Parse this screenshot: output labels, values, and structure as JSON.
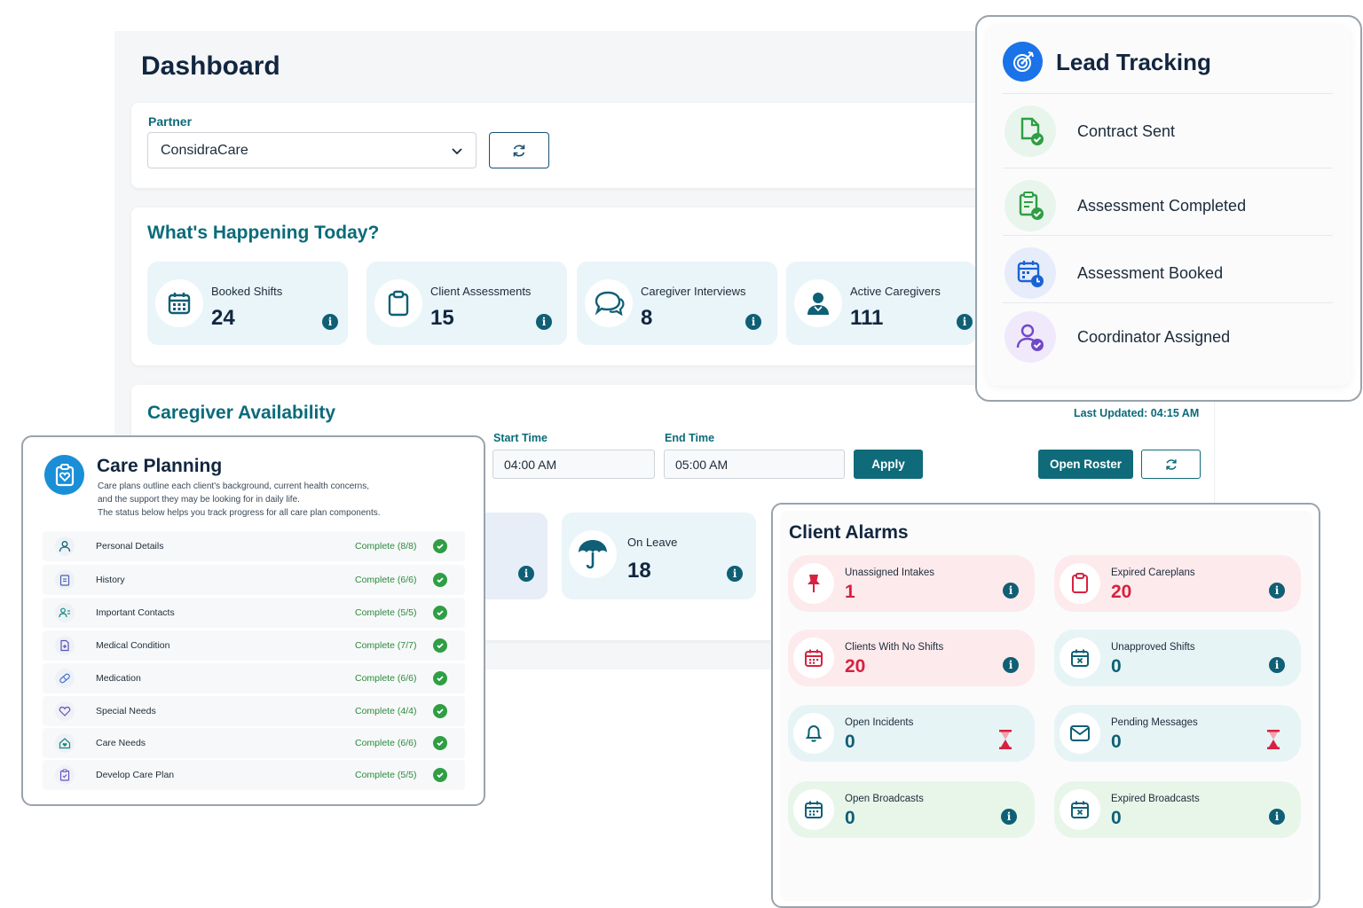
{
  "dashboard": {
    "title": "Dashboard",
    "partner_label": "Partner",
    "partner_value": "ConsidraCare",
    "today_title": "What's Happening Today?",
    "stats": [
      {
        "label": "Booked Shifts",
        "value": "24",
        "icon": "calendar-icon"
      },
      {
        "label": "Client Assessments",
        "value": "15",
        "icon": "clipboard-icon"
      },
      {
        "label": "Caregiver Interviews",
        "value": "8",
        "icon": "chat-bubbles-icon"
      },
      {
        "label": "Active Caregivers",
        "value": "111",
        "icon": "person-icon"
      }
    ],
    "availability": {
      "title": "Caregiver Availability",
      "last_updated": "Last Updated: 04:15 AM",
      "start_label": "Start Time",
      "start_value": "04:00 AM",
      "end_label": "End Time",
      "end_value": "05:00 AM",
      "apply_label": "Apply",
      "open_roster_label": "Open Roster",
      "on_leave": {
        "label": "On Leave",
        "value": "18",
        "icon": "umbrella-icon"
      }
    }
  },
  "lead_tracking": {
    "title": "Lead Tracking",
    "items": [
      {
        "label": "Contract Sent",
        "icon": "document-check-icon",
        "color": "#e8f5ec"
      },
      {
        "label": "Assessment Completed",
        "icon": "clipboard-check-icon",
        "color": "#e8f5ec"
      },
      {
        "label": "Assessment Booked",
        "icon": "calendar-clock-icon",
        "color": "#e7ecfb"
      },
      {
        "label": "Coordinator Assigned",
        "icon": "user-check-icon",
        "color": "#efe9fb"
      }
    ]
  },
  "care_planning": {
    "title": "Care Planning",
    "description": [
      "Care plans outline each client's background, current health concerns,",
      "and the support they may be looking for in daily life.",
      "The status below helps you track progress for all care plan components."
    ],
    "items": [
      {
        "label": "Personal Details",
        "status": "Complete (8/8)",
        "icon": "person-outline-icon"
      },
      {
        "label": "History",
        "status": "Complete (6/6)",
        "icon": "clipboard-list-icon"
      },
      {
        "label": "Important Contacts",
        "status": "Complete (5/5)",
        "icon": "contacts-icon"
      },
      {
        "label": "Medical Condition",
        "status": "Complete (7/7)",
        "icon": "medical-document-icon"
      },
      {
        "label": "Medication",
        "status": "Complete (6/6)",
        "icon": "pill-icon"
      },
      {
        "label": "Special Needs",
        "status": "Complete (4/4)",
        "icon": "heart-icon"
      },
      {
        "label": "Care Needs",
        "status": "Complete (6/6)",
        "icon": "home-heart-icon"
      },
      {
        "label": "Develop Care Plan",
        "status": "Complete (5/5)",
        "icon": "clipboard-plan-icon"
      }
    ]
  },
  "client_alarms": {
    "title": "Client Alarms",
    "items": [
      {
        "label": "Unassigned Intakes",
        "value": "1",
        "icon": "pin-icon",
        "tone": "pink",
        "indicator": "info-icon"
      },
      {
        "label": "Expired Careplans",
        "value": "20",
        "icon": "clipboard-icon",
        "tone": "pink",
        "indicator": "info-icon"
      },
      {
        "label": "Clients With No Shifts",
        "value": "20",
        "icon": "calendar-icon",
        "tone": "pink",
        "indicator": "info-icon"
      },
      {
        "label": "Unapproved Shifts",
        "value": "0",
        "icon": "calendar-x-icon",
        "tone": "teal",
        "indicator": "info-icon"
      },
      {
        "label": "Open Incidents",
        "value": "0",
        "icon": "bell-icon",
        "tone": "teal",
        "indicator": "hourglass-icon"
      },
      {
        "label": "Pending Messages",
        "value": "0",
        "icon": "envelope-icon",
        "tone": "teal",
        "indicator": "hourglass-icon"
      },
      {
        "label": "Open Broadcasts",
        "value": "0",
        "icon": "calendar-icon",
        "tone": "green",
        "indicator": "info-icon"
      },
      {
        "label": "Expired Broadcasts",
        "value": "0",
        "icon": "calendar-x-icon",
        "tone": "green",
        "indicator": "info-icon"
      }
    ]
  },
  "colors": {
    "teal_accent": "#0f6b7a",
    "alarm_red": "#d6223f",
    "complete_green": "#2f9e44"
  }
}
